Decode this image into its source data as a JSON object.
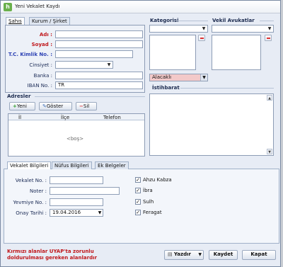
{
  "window": {
    "title": "Yeni Vekalet Kaydı"
  },
  "top_tabs": [
    "Şahıs",
    "Kurum / Şirket"
  ],
  "person_form": {
    "ad_label": "Adı :",
    "soyad_label": "Soyad :",
    "tc_label": "T.C. Kimlik No. :",
    "cinsiyet_label": "Cinsiyet :",
    "banka_label": "Banka :",
    "iban_label": "IBAN No. :",
    "iban_value": "TR"
  },
  "kategorisi": {
    "title": "Kategorisi"
  },
  "vekil": {
    "title": "Vekil Avukatlar"
  },
  "alacakli": {
    "value": "Alacaklı"
  },
  "istihbarat": {
    "title": "İstihbarat"
  },
  "adresler": {
    "title": "Adresler",
    "buttons": {
      "new": "Yeni",
      "show": "Göster",
      "delete": "Sil"
    },
    "columns": [
      "İl",
      "İlçe",
      "Telefon"
    ],
    "empty_text": "<boş>"
  },
  "bottom_tabs": [
    "Vekalet Bilgileri",
    "Nüfus Bilgileri",
    "Ek Belgeler"
  ],
  "vekalet": {
    "vekalet_no_label": "Vekalet No. :",
    "noter_label": "Noter :",
    "yevmiye_label": "Yevmiye No. :",
    "onay_label": "Onay Tarihi :",
    "onay_value": "19.04.2016"
  },
  "checkboxes": [
    {
      "label": "Ahzu Kabza",
      "checked": true
    },
    {
      "label": "İbra",
      "checked": true
    },
    {
      "label": "Sulh",
      "checked": true
    },
    {
      "label": "Feragat",
      "checked": true
    }
  ],
  "footer": {
    "note_line1": "Kırmızı alanlar UYAP'ta zorunlu",
    "note_line2": "doldurulması gereken alanlardır",
    "print": "Yazdır",
    "save": "Kaydet",
    "close": "Kapat"
  },
  "colors": {
    "required_red": "#c0171b",
    "required_blue": "#2f44b5",
    "alacakli_bg": "#f3c9c9",
    "window_bg": "#e7ecf5"
  }
}
